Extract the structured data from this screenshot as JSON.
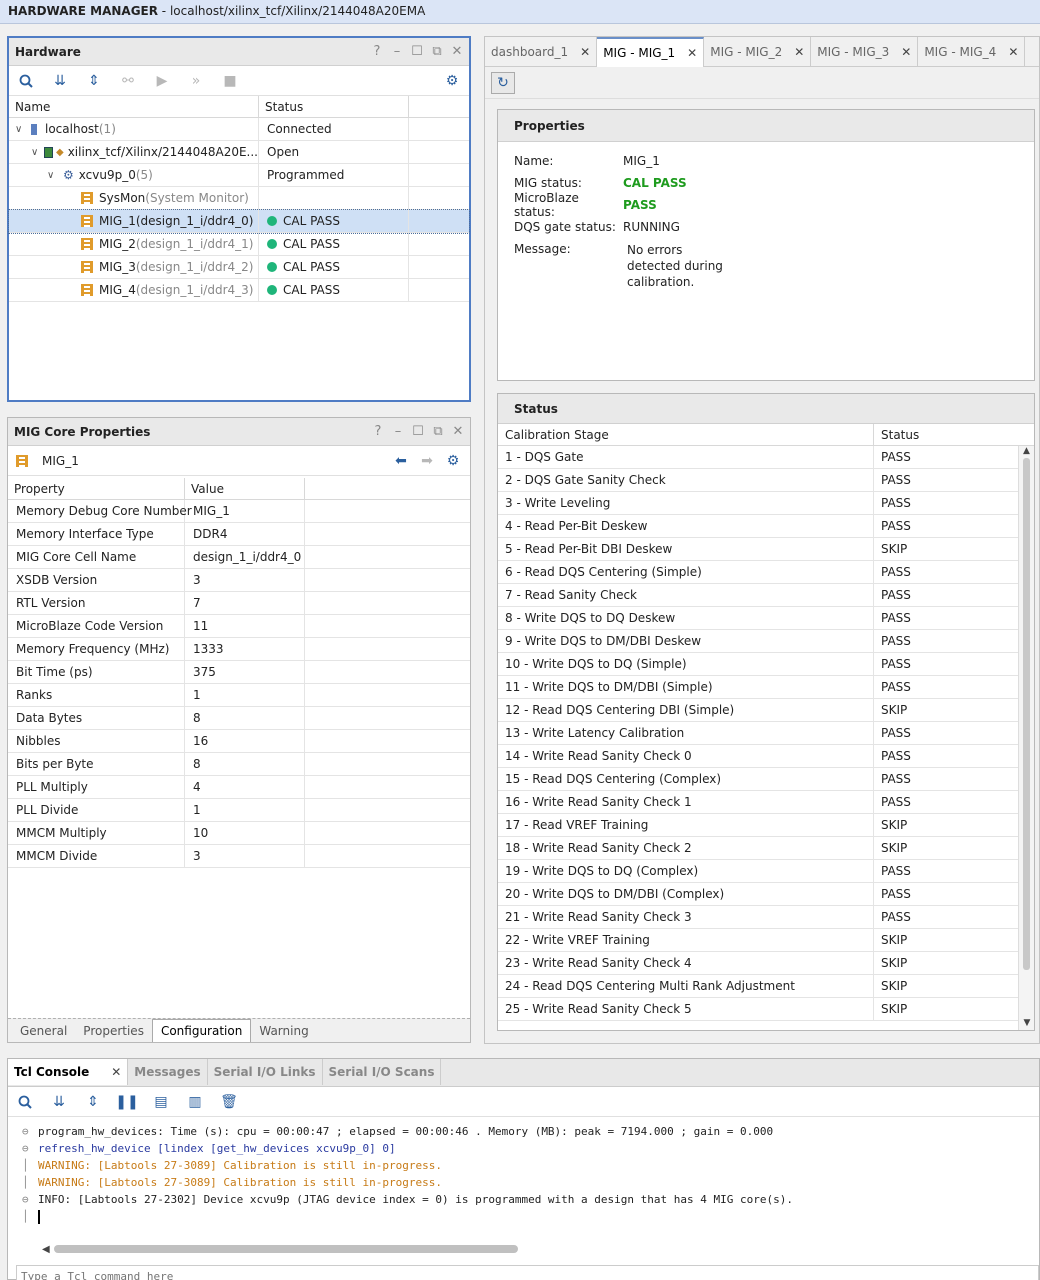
{
  "window": {
    "app": "HARDWARE MANAGER",
    "path": " - localhost/xilinx_tcf/Xilinx/2144048A20EMA"
  },
  "hardware": {
    "title": "Hardware",
    "columns": [
      "Name",
      "Status"
    ],
    "rows": [
      {
        "name": "localhost",
        "suffix": " (1)",
        "status": "Connected"
      },
      {
        "name": "xilinx_tcf/Xilinx/2144048A20E...",
        "suffix": "",
        "status": "Open"
      },
      {
        "name": "xcvu9p_0",
        "suffix": " (5)",
        "status": "Programmed"
      },
      {
        "name": "SysMon",
        "suffix": " (System Monitor)",
        "status": ""
      },
      {
        "name": "MIG_1",
        "suffix": " (design_1_i/ddr4_0)",
        "status": "CAL PASS"
      },
      {
        "name": "MIG_2",
        "suffix": " (design_1_i/ddr4_1)",
        "status": "CAL PASS"
      },
      {
        "name": "MIG_3",
        "suffix": " (design_1_i/ddr4_2)",
        "status": "CAL PASS"
      },
      {
        "name": "MIG_4",
        "suffix": " (design_1_i/ddr4_3)",
        "status": "CAL PASS"
      }
    ]
  },
  "mig_props": {
    "title": "MIG Core Properties",
    "selected": "MIG_1",
    "columns": [
      "Property",
      "Value"
    ],
    "rows": [
      [
        "Memory Debug Core Number",
        "MIG_1"
      ],
      [
        "Memory Interface Type",
        "DDR4"
      ],
      [
        "MIG Core Cell Name",
        "design_1_i/ddr4_0"
      ],
      [
        "XSDB Version",
        "3"
      ],
      [
        "RTL Version",
        "7"
      ],
      [
        "MicroBlaze Code Version",
        "11"
      ],
      [
        "Memory Frequency (MHz)",
        "1333"
      ],
      [
        "Bit Time (ps)",
        "375"
      ],
      [
        "Ranks",
        "1"
      ],
      [
        "Data Bytes",
        "8"
      ],
      [
        "Nibbles",
        "16"
      ],
      [
        "Bits per Byte",
        "8"
      ],
      [
        "PLL Multiply",
        "4"
      ],
      [
        "PLL Divide",
        "1"
      ],
      [
        "MMCM Multiply",
        "10"
      ],
      [
        "MMCM Divide",
        "3"
      ]
    ],
    "tabs": [
      "General",
      "Properties",
      "Configuration",
      "Warning"
    ]
  },
  "right_tabs": [
    "dashboard_1",
    "MIG - MIG_1",
    "MIG - MIG_2",
    "MIG - MIG_3",
    "MIG - MIG_4"
  ],
  "properties": {
    "title": "Properties",
    "name_label": "Name:",
    "name": "MIG_1",
    "mig_status_label": "MIG status:",
    "mig_status": "CAL PASS",
    "mb_status_label": "MicroBlaze status:",
    "mb_status": "PASS",
    "dqs_label": "DQS gate status:",
    "dqs": "RUNNING",
    "msg_label": "Message:",
    "msg": "No errors detected during calibration."
  },
  "status": {
    "title": "Status",
    "columns": [
      "Calibration Stage",
      "Status"
    ],
    "rows": [
      [
        "1 - DQS Gate",
        "PASS"
      ],
      [
        "2 - DQS Gate Sanity Check",
        "PASS"
      ],
      [
        "3 - Write Leveling",
        "PASS"
      ],
      [
        "4 - Read Per-Bit Deskew",
        "PASS"
      ],
      [
        "5 - Read Per-Bit DBI Deskew",
        "SKIP"
      ],
      [
        "6 - Read DQS Centering (Simple)",
        "PASS"
      ],
      [
        "7 - Read Sanity Check",
        "PASS"
      ],
      [
        "8 - Write DQS to DQ Deskew",
        "PASS"
      ],
      [
        "9 - Write DQS to DM/DBI Deskew",
        "PASS"
      ],
      [
        "10 - Write DQS to DQ (Simple)",
        "PASS"
      ],
      [
        "11 - Write DQS to DM/DBI (Simple)",
        "PASS"
      ],
      [
        "12 - Read DQS Centering DBI (Simple)",
        "SKIP"
      ],
      [
        "13 - Write Latency Calibration",
        "PASS"
      ],
      [
        "14 - Write Read Sanity Check 0",
        "PASS"
      ],
      [
        "15 - Read DQS Centering (Complex)",
        "PASS"
      ],
      [
        "16 - Write Read Sanity Check 1",
        "PASS"
      ],
      [
        "17 - Read VREF Training",
        "SKIP"
      ],
      [
        "18 - Write Read Sanity Check 2",
        "SKIP"
      ],
      [
        "19 - Write DQS to DQ (Complex)",
        "PASS"
      ],
      [
        "20 - Write DQS to DM/DBI (Complex)",
        "PASS"
      ],
      [
        "21 - Write Read Sanity Check 3",
        "PASS"
      ],
      [
        "22 - Write VREF Training",
        "SKIP"
      ],
      [
        "23 - Write Read Sanity Check 4",
        "SKIP"
      ],
      [
        "24 - Read DQS Centering Multi Rank Adjustment",
        "SKIP"
      ],
      [
        "25 - Write Read Sanity Check 5",
        "SKIP"
      ]
    ]
  },
  "console": {
    "tabs": [
      "Tcl Console",
      "Messages",
      "Serial I/O Links",
      "Serial I/O Scans"
    ],
    "lines": [
      {
        "text": "program_hw_devices: Time (s): cpu = 00:00:47 ; elapsed = 00:00:46 . Memory (MB): peak = 7194.000 ; gain = 0.000",
        "kind": "normal"
      },
      {
        "text": "refresh_hw_device [lindex [get_hw_devices xcvu9p_0] 0]",
        "kind": "cmd"
      },
      {
        "text": "WARNING: [Labtools 27-3089] Calibration is still in-progress.",
        "kind": "warn"
      },
      {
        "text": "WARNING: [Labtools 27-3089] Calibration is still in-progress.",
        "kind": "warn"
      },
      {
        "text": "INFO: [Labtools 27-2302] Device xcvu9p (JTAG device index = 0) is programmed with a design that has 4 MIG core(s).",
        "kind": "normal"
      }
    ],
    "placeholder": "Type a Tcl command here"
  }
}
